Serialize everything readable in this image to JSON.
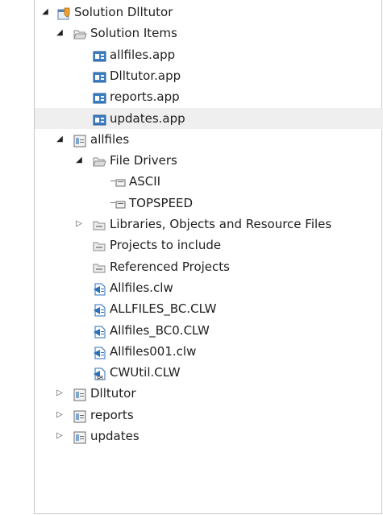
{
  "tree": [
    {
      "label": "Solution Dlltutor",
      "icon": "solution-icon",
      "expander": "expanded",
      "level": 0
    },
    {
      "label": "Solution Items",
      "icon": "open-folder-icon",
      "expander": "expanded",
      "level": 1
    },
    {
      "label": "allfiles.app",
      "icon": "app-file-icon",
      "expander": "none",
      "level": 2
    },
    {
      "label": "Dlltutor.app",
      "icon": "app-file-icon",
      "expander": "none",
      "level": 2
    },
    {
      "label": "reports.app",
      "icon": "app-file-icon",
      "expander": "none",
      "level": 2
    },
    {
      "label": "updates.app",
      "icon": "app-file-icon",
      "expander": "none",
      "level": 2,
      "selected": true
    },
    {
      "label": "allfiles",
      "icon": "project-icon",
      "expander": "expanded",
      "level": 1
    },
    {
      "label": "File Drivers",
      "icon": "open-folder-icon",
      "expander": "expanded",
      "level": 2
    },
    {
      "label": "ASCII",
      "icon": "driver-icon",
      "expander": "none",
      "level": 3
    },
    {
      "label": "TOPSPEED",
      "icon": "driver-icon",
      "expander": "none",
      "level": 3
    },
    {
      "label": "Libraries, Objects and Resource Files",
      "icon": "folder-icon",
      "expander": "collapsed",
      "level": 2
    },
    {
      "label": "Projects to include",
      "icon": "folder-icon",
      "expander": "none",
      "level": 2
    },
    {
      "label": "Referenced Projects",
      "icon": "folder-icon",
      "expander": "none",
      "level": 2
    },
    {
      "label": "Allfiles.clw",
      "icon": "clw-file-icon",
      "expander": "none",
      "level": 2
    },
    {
      "label": "ALLFILES_BC.CLW",
      "icon": "clw-file-icon",
      "expander": "none",
      "level": 2
    },
    {
      "label": "Allfiles_BC0.CLW",
      "icon": "clw-file-icon",
      "expander": "none",
      "level": 2
    },
    {
      "label": "Allfiles001.clw",
      "icon": "clw-file-icon",
      "expander": "none",
      "level": 2
    },
    {
      "label": "CWUtil.CLW",
      "icon": "clw-link-file-icon",
      "expander": "none",
      "level": 2
    },
    {
      "label": "Dlltutor",
      "icon": "project-icon",
      "expander": "collapsed",
      "level": 1
    },
    {
      "label": "reports",
      "icon": "project-icon",
      "expander": "collapsed",
      "level": 1
    },
    {
      "label": "updates",
      "icon": "project-icon",
      "expander": "collapsed",
      "level": 1
    }
  ],
  "colors": {
    "selected_row": "#efefef",
    "app_icon": "#3d7fc4",
    "clw_icon": "#2c6fb8",
    "folder_icon": "#9a9a9a"
  }
}
